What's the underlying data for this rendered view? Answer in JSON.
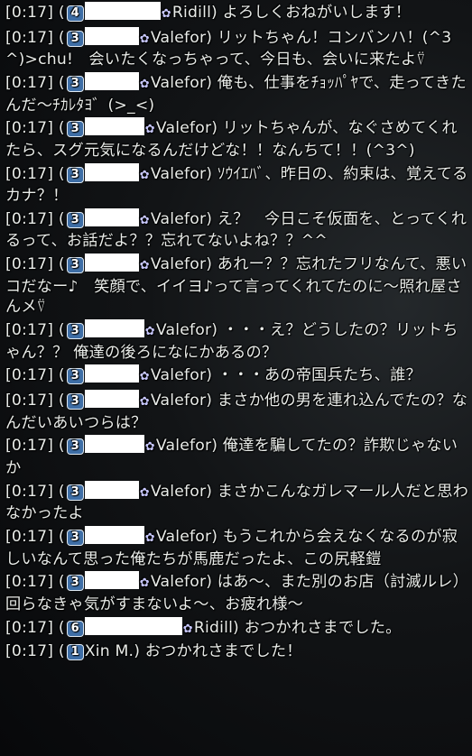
{
  "chat": {
    "world_icon_name": "world-flower-icon",
    "lines": [
      {
        "time": "[0:17]",
        "open": "(",
        "ls": "4",
        "world": "Ridill",
        "close": ")",
        "msg": " よろしくおねがいします！"
      },
      {
        "time": "[0:17]",
        "open": "(",
        "ls": "3",
        "world": "Valefor",
        "close": ")",
        "msg": " リットちゃん！コンバンハ！(^3^)>chu!　会いたくなっちゃって、今日も、会いに来たよ⍢"
      },
      {
        "time": "[0:17]",
        "open": "(",
        "ls": "3",
        "world": "Valefor",
        "close": ")",
        "msg": "  俺も、仕事をﾁｮｯﾊﾟﾔで、走ってきたんだ～ﾁｶﾚﾀﾖ゛(>_<)"
      },
      {
        "time": "[0:17]",
        "open": "(",
        "ls": "3",
        "world": "Valefor",
        "close": ")",
        "msg": " リットちゃんが、なぐさめてくれたら、スグ元気になるんだけどな！！なんちて！！(^3^)"
      },
      {
        "time": "[0:17]",
        "open": "(",
        "ls": "3",
        "world": "Valefor",
        "close": ")",
        "msg": " ｿｳｲｴﾊﾞ、昨日の、約束は、覚えてるカナ？！"
      },
      {
        "time": "[0:17]",
        "open": "(",
        "ls": "3",
        "world": "Valefor",
        "close": ")",
        "msg": " え？　今日こそ仮面を、とってくれるって、お話だよ？？忘れてないよね？？^^"
      },
      {
        "time": "[0:17]",
        "open": "(",
        "ls": "3",
        "world": "Valefor",
        "close": ")",
        "msg": " あれー？？忘れたフリなんて、悪いコだなー♪　笑顔で、イイヨ♪って言ってくれてたのに～照れ屋さんメ⍢"
      },
      {
        "time": "[0:17]",
        "open": "(",
        "ls": "3",
        "world": "Valefor",
        "close": ")",
        "msg": " ・・・え？どうしたの？リットちゃん？？ 俺達の後ろになにかあるの？"
      },
      {
        "time": "[0:17]",
        "open": "(",
        "ls": "3",
        "world": "Valefor",
        "close": ")",
        "msg": " ・・・あの帝国兵たち、誰？"
      },
      {
        "time": "[0:17]",
        "open": "(",
        "ls": "3",
        "world": "Valefor",
        "close": ")",
        "msg": " まさか他の男を連れ込んでたの？なんだいあいつらは？"
      },
      {
        "time": "[0:17]",
        "open": "(",
        "ls": "3",
        "world": "Valefor",
        "close": ")",
        "msg": " 俺達を騙してたの？詐欺じゃないか"
      },
      {
        "time": "[0:17]",
        "open": "(",
        "ls": "3",
        "world": "Valefor",
        "close": ")",
        "msg": "  まさかこんなガレマール人だと思わなかったよ"
      },
      {
        "time": "[0:17]",
        "open": "(",
        "ls": "3",
        "world": "Valefor",
        "close": ")",
        "msg": "  もうこれから会えなくなるのが寂しいなんて思った俺たちが馬鹿だったよ、この尻軽鎧"
      },
      {
        "time": "[0:17]",
        "open": "(",
        "ls": "3",
        "world": "Valefor",
        "close": ")",
        "msg": " はあ～、また別のお店（討滅ルレ）回らなきゃ気がすまないよ～、お疲れ様～"
      },
      {
        "time": "[0:17]",
        "open": "(",
        "ls": "6",
        "world": "Ridill",
        "close": ")",
        "msg": " おつかれさまでした。"
      },
      {
        "time": "[0:17]",
        "open": "(",
        "ls": "1",
        "name": "Xin M.",
        "close": ")",
        "msg": " おつかれさまでした！"
      }
    ]
  }
}
